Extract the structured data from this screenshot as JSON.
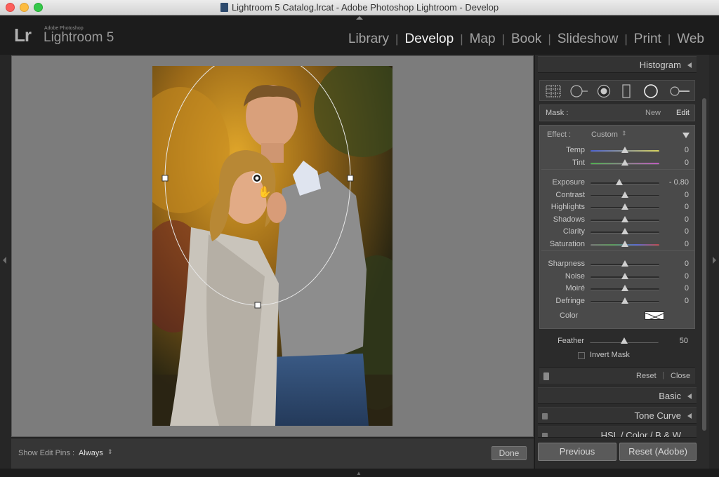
{
  "window": {
    "title": "Lightroom 5 Catalog.lrcat - Adobe Photoshop Lightroom - Develop"
  },
  "identity": {
    "logo": "Lr",
    "brand_small": "Adobe Photoshop",
    "brand": "Lightroom 5"
  },
  "modules": [
    {
      "label": "Library",
      "active": false
    },
    {
      "label": "Develop",
      "active": true
    },
    {
      "label": "Map",
      "active": false
    },
    {
      "label": "Book",
      "active": false
    },
    {
      "label": "Slideshow",
      "active": false
    },
    {
      "label": "Print",
      "active": false
    },
    {
      "label": "Web",
      "active": false
    }
  ],
  "module_separator": "|",
  "panel": {
    "histogram_title": "Histogram",
    "tools": [
      "crop-overlay-icon",
      "spot-removal-icon",
      "red-eye-correction-icon",
      "graduated-filter-icon",
      "radial-filter-icon",
      "adjustment-brush-icon"
    ],
    "mask": {
      "label": "Mask :",
      "new": "New",
      "edit": "Edit"
    },
    "effect": {
      "label": "Effect :",
      "value": "Custom"
    },
    "slider_groups": [
      [
        {
          "label": "Temp",
          "value": "0",
          "pos": 0.5,
          "track": "temp"
        },
        {
          "label": "Tint",
          "value": "0",
          "pos": 0.5,
          "track": "tint"
        }
      ],
      [
        {
          "label": "Exposure",
          "value": "- 0.80",
          "pos": 0.42,
          "track": "plain"
        },
        {
          "label": "Contrast",
          "value": "0",
          "pos": 0.5,
          "track": "plain"
        },
        {
          "label": "Highlights",
          "value": "0",
          "pos": 0.5,
          "track": "plain"
        },
        {
          "label": "Shadows",
          "value": "0",
          "pos": 0.5,
          "track": "plain"
        },
        {
          "label": "Clarity",
          "value": "0",
          "pos": 0.5,
          "track": "plain"
        },
        {
          "label": "Saturation",
          "value": "0",
          "pos": 0.5,
          "track": "saturation"
        }
      ],
      [
        {
          "label": "Sharpness",
          "value": "0",
          "pos": 0.5,
          "track": "plain"
        },
        {
          "label": "Noise",
          "value": "0",
          "pos": 0.5,
          "track": "plain"
        },
        {
          "label": "Moiré",
          "value": "0",
          "pos": 0.5,
          "track": "plain"
        },
        {
          "label": "Defringe",
          "value": "0",
          "pos": 0.5,
          "track": "plain"
        }
      ]
    ],
    "color_label": "Color",
    "feather": {
      "label": "Feather",
      "value": "50",
      "pos": 0.5
    },
    "invert_mask": {
      "label": "Invert Mask",
      "checked": false
    },
    "reset": "Reset",
    "close": "Close",
    "sections": [
      {
        "title": "Basic"
      },
      {
        "title": "Tone Curve"
      },
      {
        "title": "HSL / Color / B & W"
      }
    ],
    "previous": "Previous",
    "reset_adobe": "Reset (Adobe)"
  },
  "toolbar": {
    "pins_label": "Show Edit Pins :",
    "pins_value": "Always",
    "done": "Done"
  },
  "colors": {
    "accent": "#f2f2f2",
    "temp_track": [
      "#4a5fd0",
      "#d6d35a"
    ],
    "tint_track": [
      "#4fb04f",
      "#c05ac0"
    ]
  }
}
